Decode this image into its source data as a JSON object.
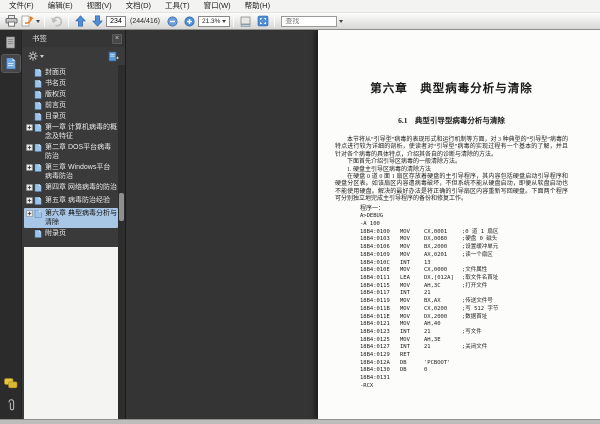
{
  "icons": {
    "close": "×"
  },
  "menu_bar": {
    "items": [
      "文件(F)",
      "编辑(E)",
      "视图(V)",
      "文档(D)",
      "工具(T)",
      "窗口(W)",
      "帮助(H)"
    ]
  },
  "toolbar": {
    "page_number": "234",
    "page_count_text": "(244/416)",
    "zoom_level": "21.3%",
    "search_placeholder": "查找"
  },
  "bookmarks_panel": {
    "title": "书签",
    "items": [
      {
        "label": "封面页",
        "expandable": false,
        "selected": false
      },
      {
        "label": "书名页",
        "expandable": false,
        "selected": false
      },
      {
        "label": "版权页",
        "expandable": false,
        "selected": false
      },
      {
        "label": "前言页",
        "expandable": false,
        "selected": false
      },
      {
        "label": "目录页",
        "expandable": false,
        "selected": false
      },
      {
        "label": "第一章 计算机病毒的概念及特征",
        "expandable": true,
        "selected": false
      },
      {
        "label": "第二章 DOS平台病毒防治",
        "expandable": true,
        "selected": false
      },
      {
        "label": "第三章 Windows平台病毒防治",
        "expandable": true,
        "selected": false
      },
      {
        "label": "第四章 网络病毒的防治",
        "expandable": true,
        "selected": false
      },
      {
        "label": "第五章 病毒防治经验",
        "expandable": true,
        "selected": false
      },
      {
        "label": "第六章 典型病毒分析与清除",
        "expandable": true,
        "selected": true
      },
      {
        "label": "附录页",
        "expandable": false,
        "selected": false
      }
    ]
  },
  "document": {
    "chapter_title": "第六章　典型病毒分析与清除",
    "section_title": "6.1　典型引导型病毒分析与清除",
    "paragraphs": [
      "本节将从“引导型”病毒的表现形式和运行机制等方面，对 3 种典型的“引导型”病毒的特点进行较为详细的剖析，使读者对“引导型”病毒的实现过程有一个基本的了解，并且针对各个病毒的具体特点，介绍其各自的诊断与清除的方法。",
      "下面首先介绍引导区病毒的一般清除方法。",
      "在硬盘 0 道 0 面 1 扇区存放着硬盘的主引导程序，其内容包括硬盘启动引导程序和硬盘分区表。如该扇区内容遭病毒破坏，不但系统不能从硬盘启动，即便从软盘启动也不能使用硬盘。解决的最好办法是将正确的引导扇区内容重新写回硬盘。下面两个程序可分别独立地完成主引导程序的备份和修复工作。"
    ],
    "list_heading": "1. 硬盘主引导区病毒的清除方法",
    "program_label": "程序一：",
    "code_lines": [
      [
        "A>DEBUG",
        "",
        "",
        ""
      ],
      [
        "-A 100",
        "",
        "",
        ""
      ],
      [
        "18B4:0100",
        "MOV",
        "CX,0001",
        ";0 道 1 扇区"
      ],
      [
        "18B4:0103",
        "MOV",
        "DX,0080",
        ";硬盘 0 磁头"
      ],
      [
        "18B4:0106",
        "MOV",
        "BX,2000",
        ";设置缓冲单元"
      ],
      [
        "18B4:0109",
        "MOV",
        "AX,0201",
        ";读一个扇区"
      ],
      [
        "18B4:010C",
        "INT",
        "13",
        ""
      ],
      [
        "18B4:010E",
        "MOV",
        "CX,0000",
        ";文件属性"
      ],
      [
        "18B4:0111",
        "LEA",
        "DX,[012A]",
        ";取文件名首址"
      ],
      [
        "18B4:0115",
        "MOV",
        "AH,3C",
        ";打开文件"
      ],
      [
        "18B4:0117",
        "INT",
        "21",
        ""
      ],
      [
        "18B4:0119",
        "MOV",
        "BX,AX",
        ";传送文件号"
      ],
      [
        "18B4:011B",
        "MOV",
        "CX,0200",
        ";写 512 字节"
      ],
      [
        "18B4:011E",
        "MOV",
        "DX,2000",
        ";数据首址"
      ],
      [
        "18B4:0121",
        "MOV",
        "AH,40",
        ""
      ],
      [
        "18B4:0123",
        "INT",
        "21",
        ";写文件"
      ],
      [
        "18B4:0125",
        "MOV",
        "AH,3E",
        ""
      ],
      [
        "18B4:0127",
        "INT",
        "21",
        ";关闭文件"
      ],
      [
        "18B4:0129",
        "RET",
        "",
        ""
      ],
      [
        "18B4:012A",
        "DB",
        "'PCBOOT'",
        ""
      ],
      [
        "18B4:0130",
        "DB",
        "0",
        ""
      ],
      [
        "18B4:0131",
        "",
        "",
        ""
      ],
      [
        "-RCX",
        "",
        "",
        ""
      ]
    ]
  }
}
